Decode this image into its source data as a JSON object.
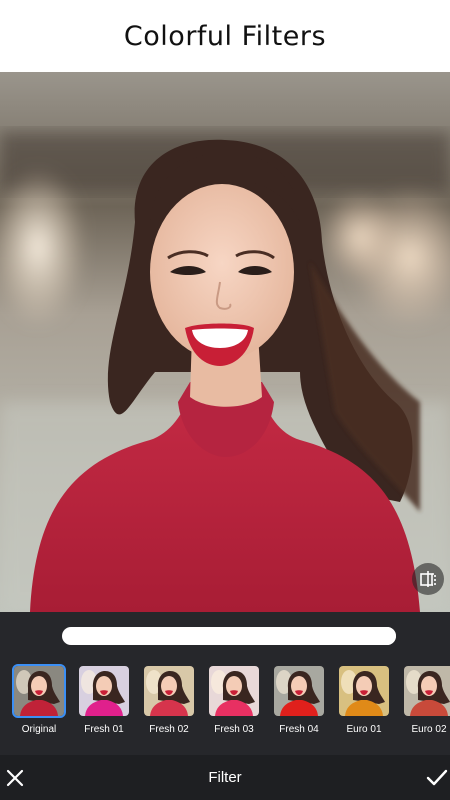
{
  "banner": {
    "title": "Colorful Filters"
  },
  "photo": {
    "description_icon": "portrait-photo"
  },
  "compare": {
    "icon": "compare-split-icon"
  },
  "intensity": {
    "value": 1.0
  },
  "filters": [
    {
      "label": "Original",
      "selected": true,
      "tint": "#c02238",
      "bg": "#8a8880"
    },
    {
      "label": "Fresh 01",
      "selected": false,
      "tint": "#e0208c",
      "bg": "#d8d0e0"
    },
    {
      "label": "Fresh 02",
      "selected": false,
      "tint": "#d6344c",
      "bg": "#d8c8a8"
    },
    {
      "label": "Fresh 03",
      "selected": false,
      "tint": "#e83062",
      "bg": "#e8d8d8"
    },
    {
      "label": "Fresh 04",
      "selected": false,
      "tint": "#e0201c",
      "bg": "#a8a8a0"
    },
    {
      "label": "Euro 01",
      "selected": false,
      "tint": "#e08a18",
      "bg": "#d8c080"
    },
    {
      "label": "Euro 02",
      "selected": false,
      "tint": "#c84a3a",
      "bg": "#bfb8a8"
    }
  ],
  "toolbar": {
    "title": "Filter",
    "close_icon": "close-icon",
    "confirm_icon": "checkmark-icon"
  }
}
